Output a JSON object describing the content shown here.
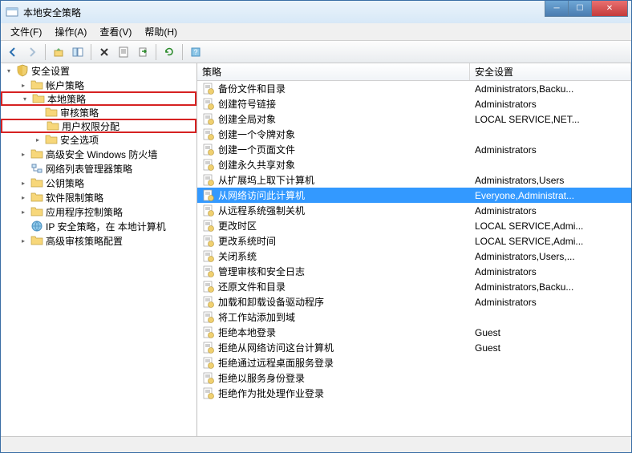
{
  "window": {
    "title": "本地安全策略"
  },
  "menu": {
    "file": "文件(F)",
    "action": "操作(A)",
    "view": "查看(V)",
    "help": "帮助(H)"
  },
  "list_headers": {
    "policy": "策略",
    "setting": "安全设置"
  },
  "tree": {
    "root": "安全设置",
    "account_policy": "帐户策略",
    "local_policy": "本地策略",
    "audit_policy": "审核策略",
    "user_rights": "用户权限分配",
    "security_options": "安全选项",
    "firewall": "高级安全 Windows 防火墙",
    "netlist": "网络列表管理器策略",
    "pubkey": "公钥策略",
    "sw_restrict": "软件限制策略",
    "app_control": "应用程序控制策略",
    "ipsec": "IP 安全策略，在 本地计算机",
    "adv_audit": "高级审核策略配置"
  },
  "policies": [
    {
      "name": "备份文件和目录",
      "setting": "Administrators,Backu..."
    },
    {
      "name": "创建符号链接",
      "setting": "Administrators"
    },
    {
      "name": "创建全局对象",
      "setting": "LOCAL SERVICE,NET..."
    },
    {
      "name": "创建一个令牌对象",
      "setting": ""
    },
    {
      "name": "创建一个页面文件",
      "setting": "Administrators"
    },
    {
      "name": "创建永久共享对象",
      "setting": ""
    },
    {
      "name": "从扩展坞上取下计算机",
      "setting": "Administrators,Users"
    },
    {
      "name": "从网络访问此计算机",
      "setting": "Everyone,Administrat...",
      "selected": true
    },
    {
      "name": "从远程系统强制关机",
      "setting": "Administrators"
    },
    {
      "name": "更改时区",
      "setting": "LOCAL SERVICE,Admi..."
    },
    {
      "name": "更改系统时间",
      "setting": "LOCAL SERVICE,Admi..."
    },
    {
      "name": "关闭系统",
      "setting": "Administrators,Users,..."
    },
    {
      "name": "管理审核和安全日志",
      "setting": "Administrators"
    },
    {
      "name": "还原文件和目录",
      "setting": "Administrators,Backu..."
    },
    {
      "name": "加载和卸载设备驱动程序",
      "setting": "Administrators"
    },
    {
      "name": "将工作站添加到域",
      "setting": ""
    },
    {
      "name": "拒绝本地登录",
      "setting": "Guest"
    },
    {
      "name": "拒绝从网络访问这台计算机",
      "setting": "Guest"
    },
    {
      "name": "拒绝通过远程桌面服务登录",
      "setting": ""
    },
    {
      "name": "拒绝以服务身份登录",
      "setting": ""
    },
    {
      "name": "拒绝作为批处理作业登录",
      "setting": ""
    }
  ]
}
